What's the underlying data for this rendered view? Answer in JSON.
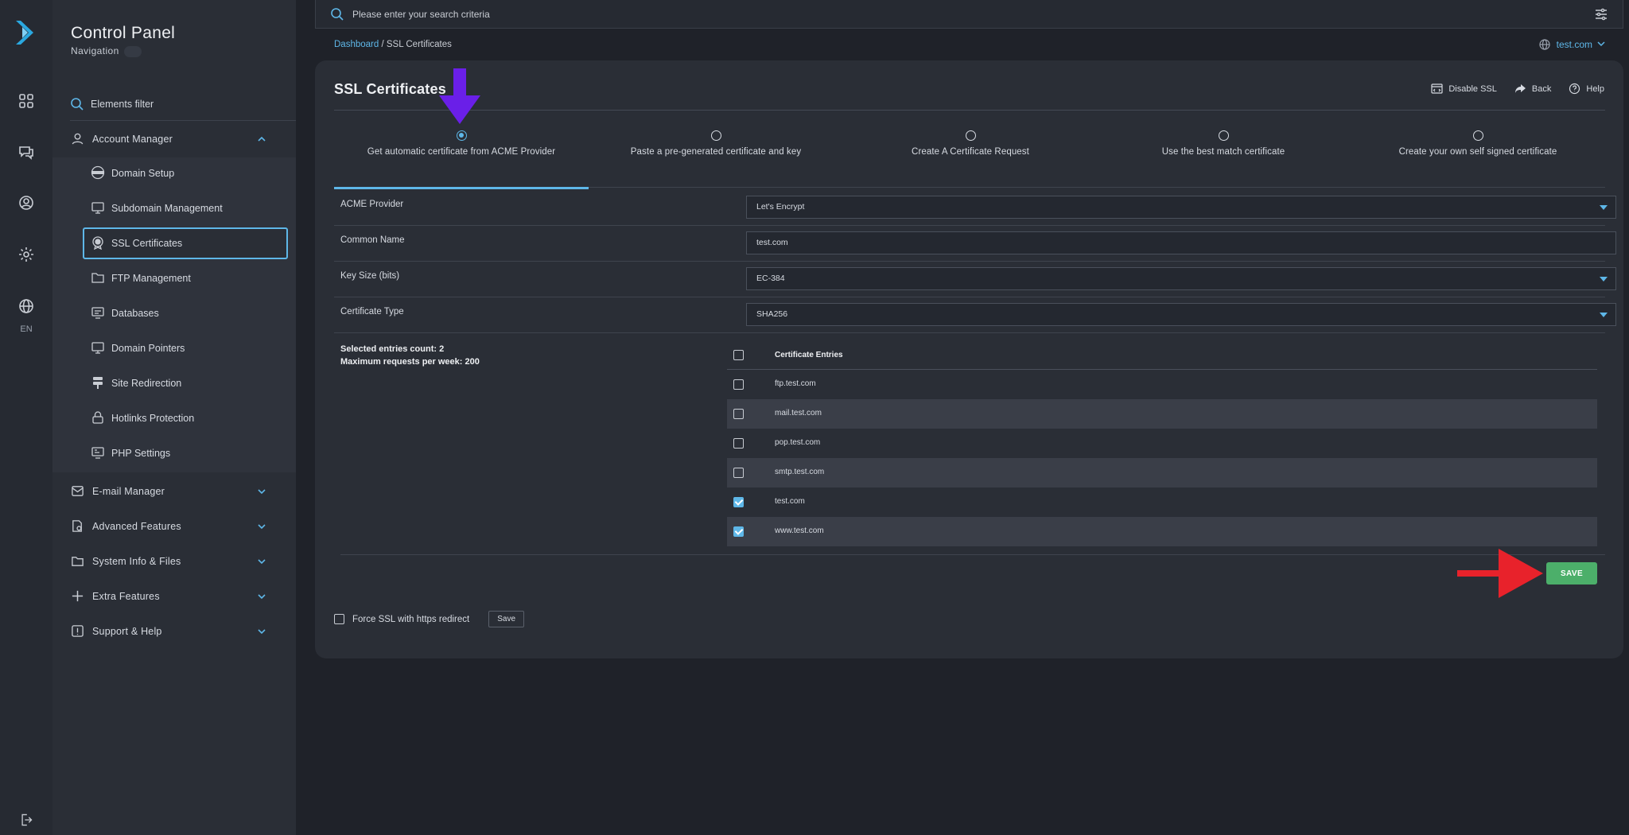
{
  "app": {
    "title": "Control Panel",
    "subtitle": "Navigation"
  },
  "rail": {
    "icons": [
      "logo-icon",
      "apps-grid-icon",
      "chat-icon",
      "user-circle-icon",
      "gear-icon",
      "globe-icon",
      "logout-icon"
    ],
    "language": "EN"
  },
  "sidebar": {
    "filter_label": "Elements filter",
    "groups": [
      {
        "label": "Account Manager",
        "icon": "user-icon",
        "expanded": true
      },
      {
        "label": "E-mail Manager",
        "icon": "mail-icon"
      },
      {
        "label": "Advanced Features",
        "icon": "document-gear-icon"
      },
      {
        "label": "System Info & Files",
        "icon": "folder-icon"
      },
      {
        "label": "Extra Features",
        "icon": "plus-icon"
      },
      {
        "label": "Support & Help",
        "icon": "alert-icon"
      }
    ],
    "items": [
      {
        "label": "Domain Setup",
        "icon": "www-globe-icon"
      },
      {
        "label": "Subdomain Management",
        "icon": "monitor-icon"
      },
      {
        "label": "SSL Certificates",
        "icon": "certificate-icon",
        "active": true
      },
      {
        "label": "FTP Management",
        "icon": "ftp-folder-icon"
      },
      {
        "label": "Databases",
        "icon": "database-monitor-icon"
      },
      {
        "label": "Domain Pointers",
        "icon": "monitor-icon"
      },
      {
        "label": "Site Redirection",
        "icon": "signpost-icon"
      },
      {
        "label": "Hotlinks Protection",
        "icon": "lock-icon"
      },
      {
        "label": "PHP Settings",
        "icon": "php-monitor-icon"
      }
    ]
  },
  "search": {
    "placeholder": "Please enter your search criteria"
  },
  "breadcrumb": {
    "root": "Dashboard",
    "separator": " / ",
    "current": "SSL Certificates"
  },
  "domain_selector": {
    "value": "test.com"
  },
  "page": {
    "title": "SSL Certificates",
    "actions": {
      "disable_ssl": "Disable SSL",
      "back": "Back",
      "help": "Help"
    },
    "tabs": [
      {
        "label": "Get automatic certificate from ACME Provider",
        "selected": true
      },
      {
        "label": "Paste a pre-generated certificate and key"
      },
      {
        "label": "Create A Certificate Request"
      },
      {
        "label": "Use the best match certificate"
      },
      {
        "label": "Create your own self signed certificate"
      }
    ],
    "form": {
      "acme_provider": {
        "label": "ACME Provider",
        "value": "Let's Encrypt"
      },
      "common_name": {
        "label": "Common Name",
        "value": "test.com"
      },
      "key_size": {
        "label": "Key Size (bits)",
        "value": "EC-384"
      },
      "certificate_type": {
        "label": "Certificate Type",
        "value": "SHA256"
      }
    },
    "counts": {
      "selected": "Selected entries count: 2",
      "max_requests": "Maximum requests per week: 200"
    },
    "entries_header": "Certificate Entries",
    "entries": [
      {
        "name": "ftp.test.com",
        "checked": false
      },
      {
        "name": "mail.test.com",
        "checked": false
      },
      {
        "name": "pop.test.com",
        "checked": false
      },
      {
        "name": "smtp.test.com",
        "checked": false
      },
      {
        "name": "test.com",
        "checked": true
      },
      {
        "name": "www.test.com",
        "checked": true
      }
    ],
    "save_label": "SAVE",
    "force_ssl": {
      "label": "Force SSL with https redirect",
      "checked": false,
      "save_label": "Save"
    }
  },
  "colors": {
    "accent": "#5eb7e8",
    "save": "#4caf6a",
    "annotation_purple": "#6a1fe8",
    "annotation_red": "#e8222b"
  }
}
